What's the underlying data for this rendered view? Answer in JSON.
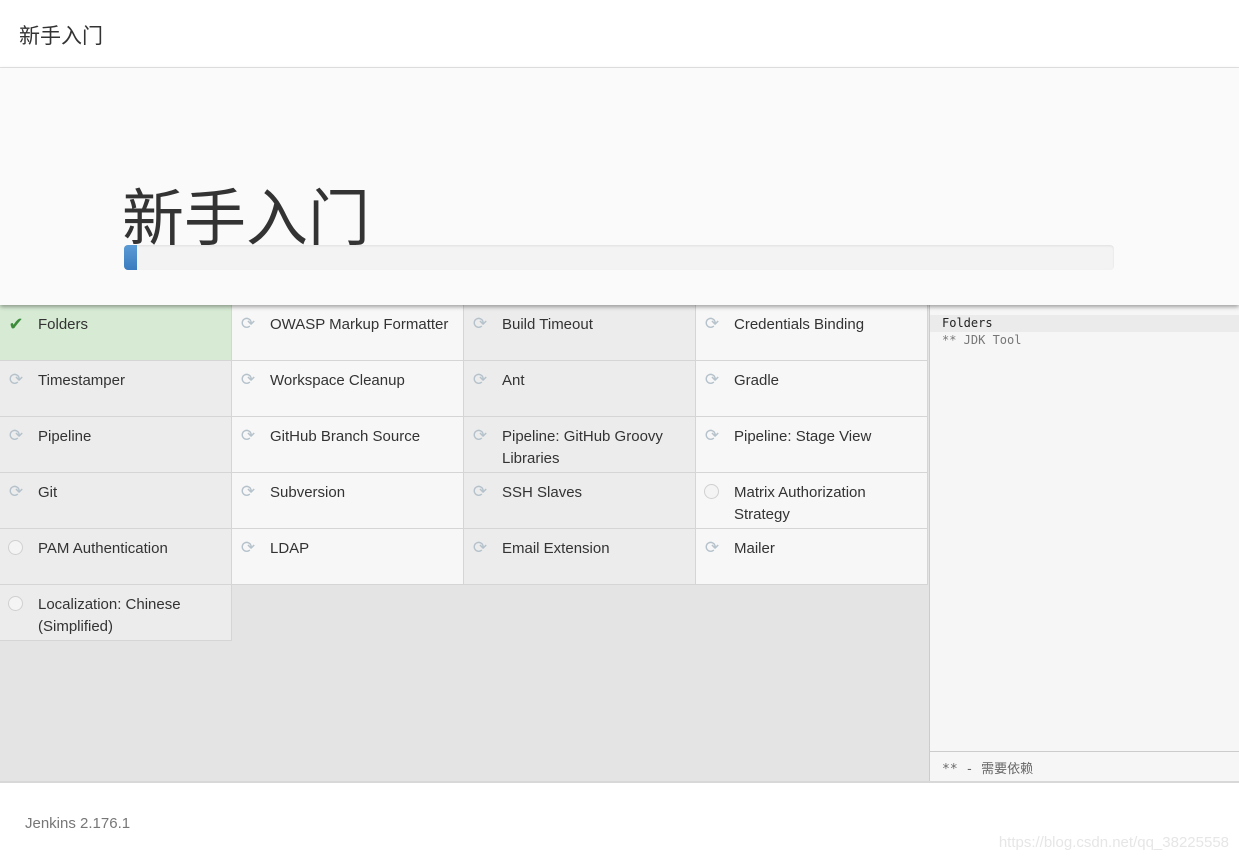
{
  "header": {
    "title": "新手入门"
  },
  "hero": {
    "title": "新手入门",
    "progress_percent": 1.3
  },
  "plugins": [
    {
      "name": "Folders",
      "status": "done"
    },
    {
      "name": "OWASP Markup Formatter",
      "status": "installing"
    },
    {
      "name": "Build Timeout",
      "status": "installing"
    },
    {
      "name": "Credentials Binding",
      "status": "installing"
    },
    {
      "name": "Timestamper",
      "status": "installing"
    },
    {
      "name": "Workspace Cleanup",
      "status": "installing"
    },
    {
      "name": "Ant",
      "status": "installing"
    },
    {
      "name": "Gradle",
      "status": "installing"
    },
    {
      "name": "Pipeline",
      "status": "installing"
    },
    {
      "name": "GitHub Branch Source",
      "status": "installing"
    },
    {
      "name": "Pipeline: GitHub Groovy Libraries",
      "status": "installing"
    },
    {
      "name": "Pipeline: Stage View",
      "status": "installing"
    },
    {
      "name": "Git",
      "status": "installing"
    },
    {
      "name": "Subversion",
      "status": "installing"
    },
    {
      "name": "SSH Slaves",
      "status": "installing"
    },
    {
      "name": "Matrix Authorization Strategy",
      "status": "pending"
    },
    {
      "name": "PAM Authentication",
      "status": "pending"
    },
    {
      "name": "LDAP",
      "status": "installing"
    },
    {
      "name": "Email Extension",
      "status": "installing"
    },
    {
      "name": "Mailer",
      "status": "installing"
    },
    {
      "name": "Localization: Chinese (Simplified)",
      "status": "pending"
    }
  ],
  "log": {
    "lines": [
      "Folders",
      "** JDK Tool"
    ],
    "legend": "** - 需要依赖"
  },
  "footer": {
    "version": "Jenkins 2.176.1",
    "watermark": "https://blog.csdn.net/qq_38225558"
  }
}
